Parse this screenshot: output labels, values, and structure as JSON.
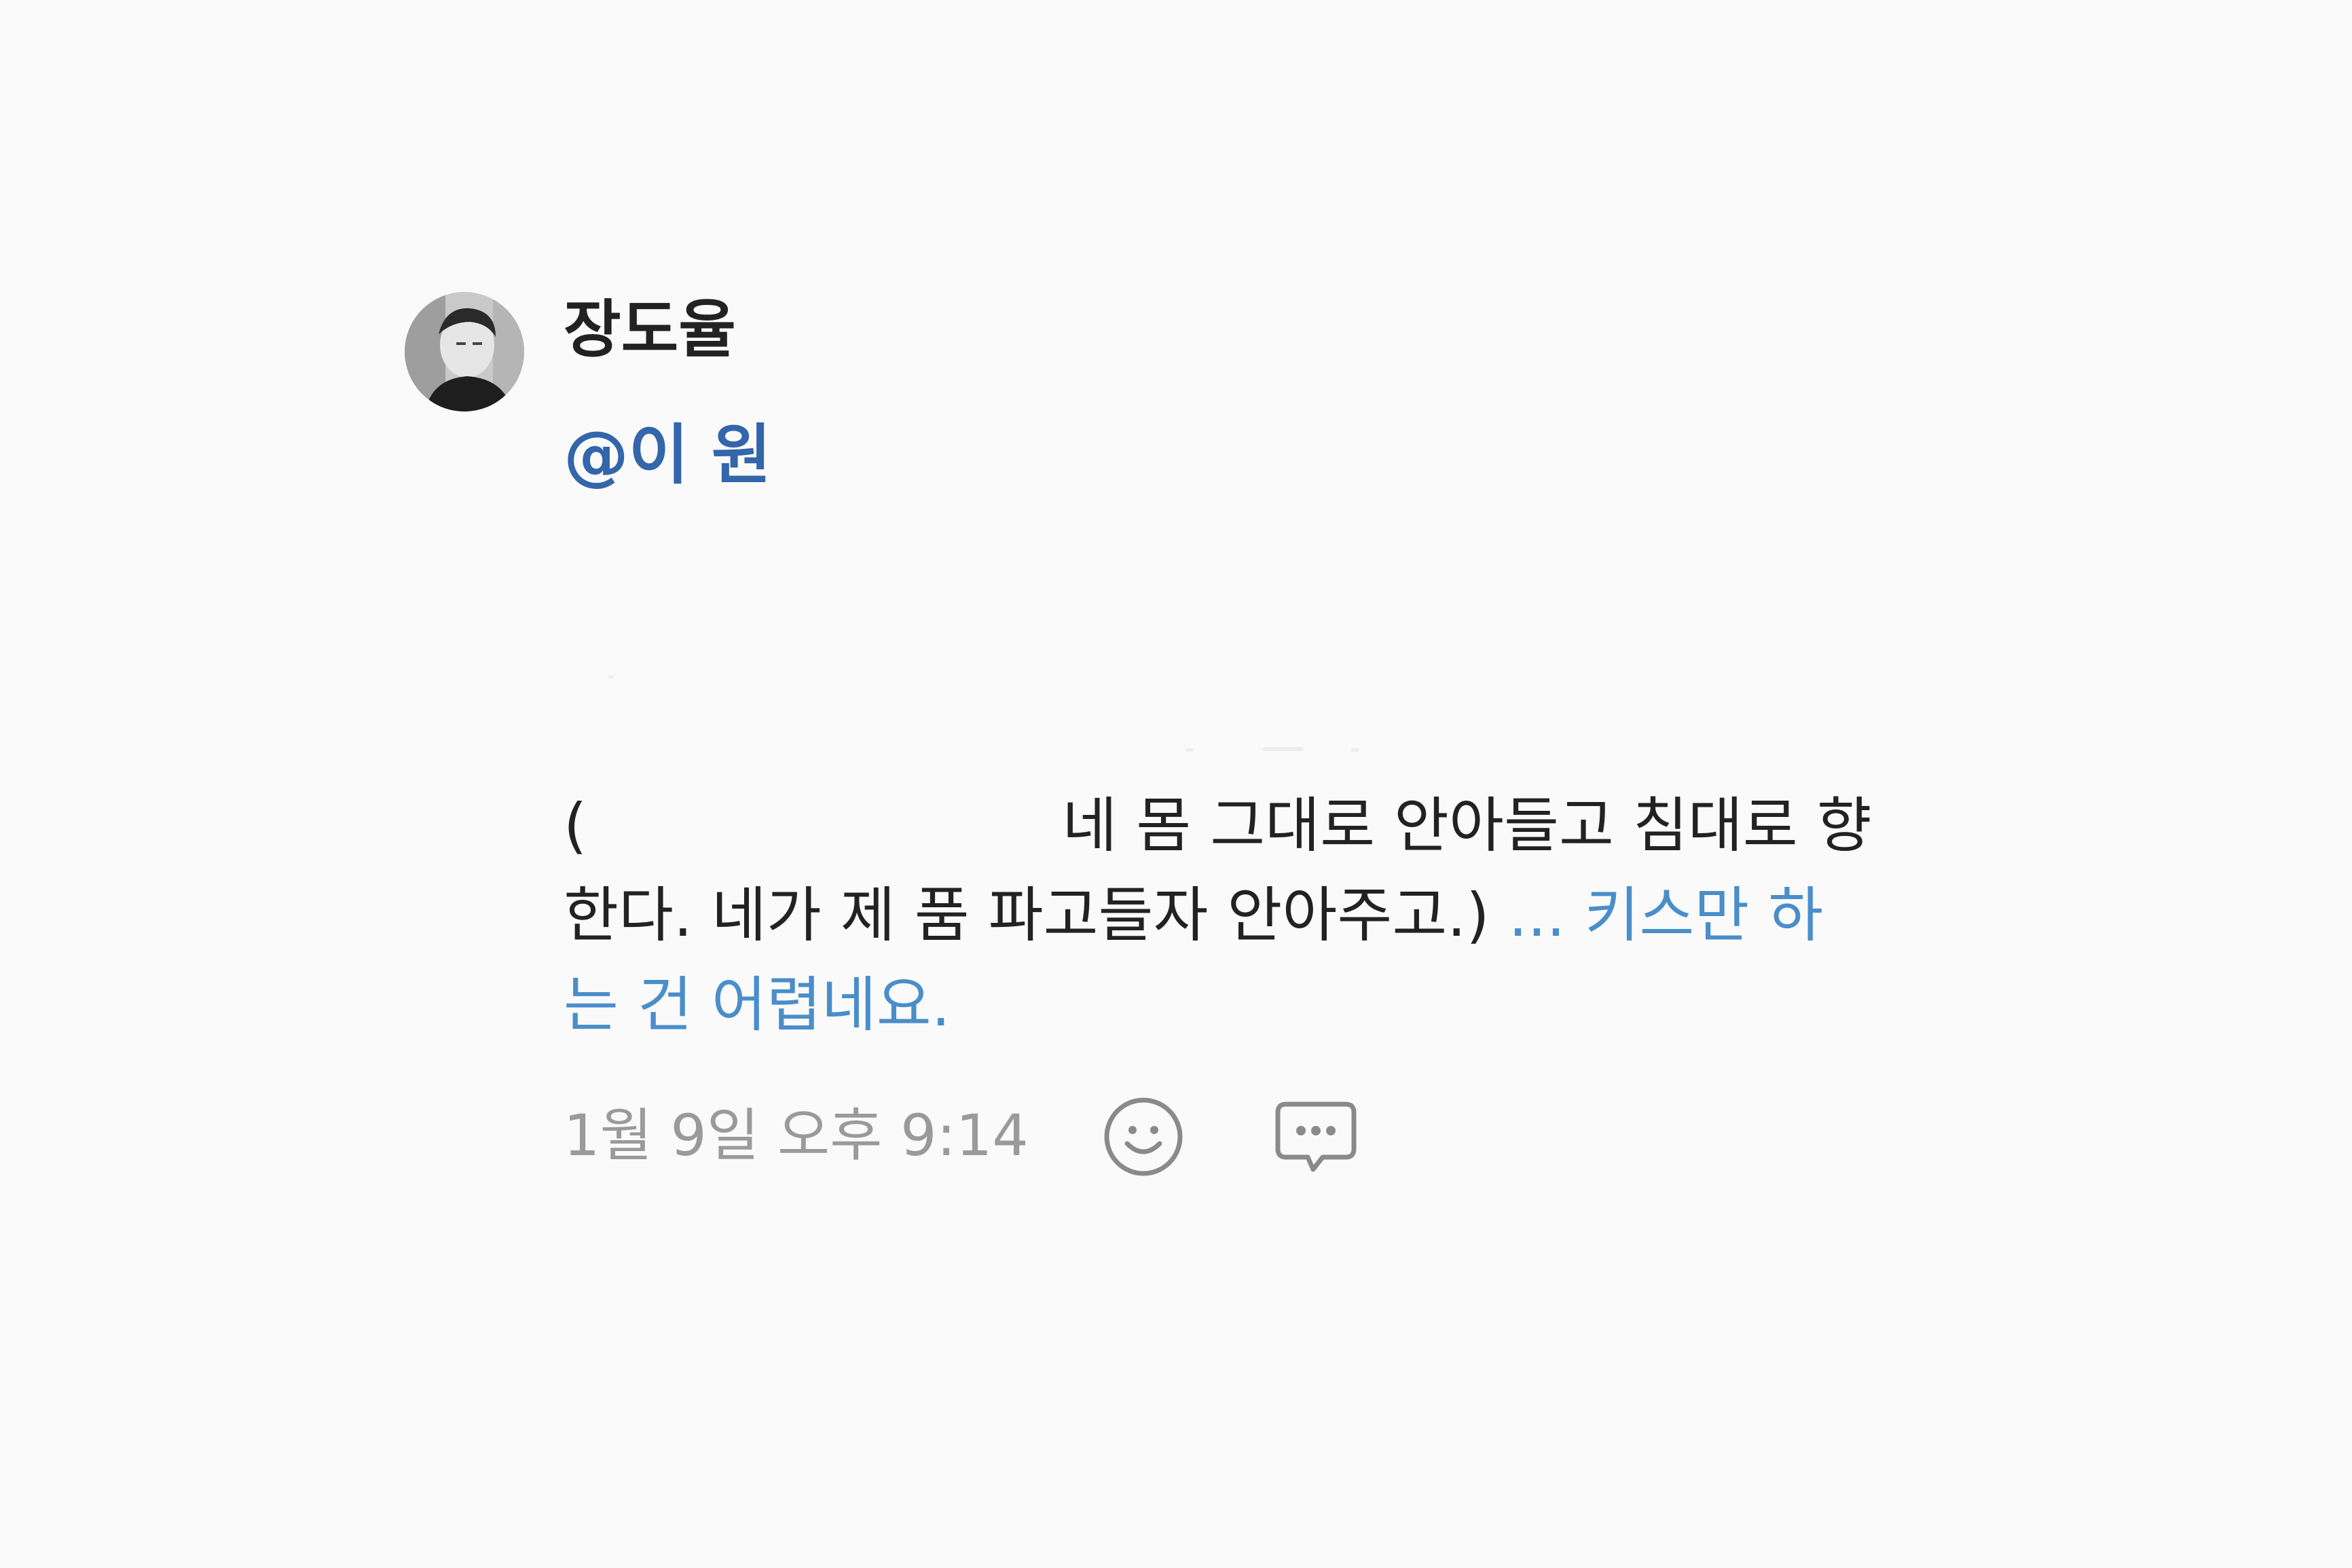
{
  "comment": {
    "author": "장도율",
    "mention": "@이 원",
    "lines": {
      "l1_start": "(",
      "l1_end": "네 몸 그대로 안아들고 침대로 향",
      "l2_text": "한다. 네가 제 품 파고들자 안아주고.)",
      "l2_link": " ... 키스만 하",
      "l3_link": "는 건 어렵네요."
    },
    "timestamp": "1월 9일 오후 9:14",
    "actions": {
      "emoji_icon": "smile-icon",
      "reply_icon": "chat-bubble-icon"
    }
  },
  "colors": {
    "background": "#fafafa",
    "author": "#222222",
    "mention": "#3366aa",
    "link": "#4a8ec9",
    "timestamp": "#9a9a9a"
  }
}
